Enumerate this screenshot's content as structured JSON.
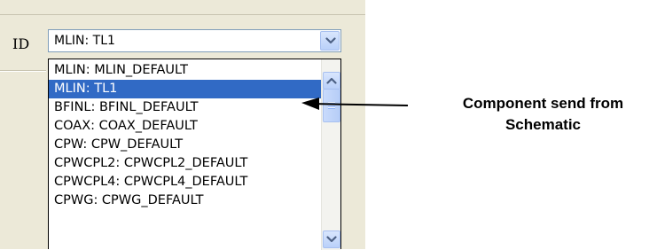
{
  "field": {
    "label": "ID",
    "value": "MLIN: TL1"
  },
  "dropdown": {
    "items": [
      "MLIN: MLIN_DEFAULT",
      "MLIN: TL1",
      "BFINL: BFINL_DEFAULT",
      "COAX: COAX_DEFAULT",
      "CPW: CPW_DEFAULT",
      "CPWCPL2: CPWCPL2_DEFAULT",
      "CPWCPL4: CPWCPL4_DEFAULT",
      "CPWG: CPWG_DEFAULT"
    ],
    "selected_item": "MLIN: TL1"
  },
  "annotation": {
    "line1": "Component send from",
    "line2": "Schematic"
  },
  "icons": {
    "combo_button": "chevron-down-icon",
    "scroll_up": "chevron-up-icon",
    "scroll_down": "chevron-down-icon",
    "callout": "arrow-left-icon"
  },
  "colors": {
    "selection": "#316ac5",
    "panel": "#ece9d8",
    "button_glyph": "#4d6185"
  }
}
